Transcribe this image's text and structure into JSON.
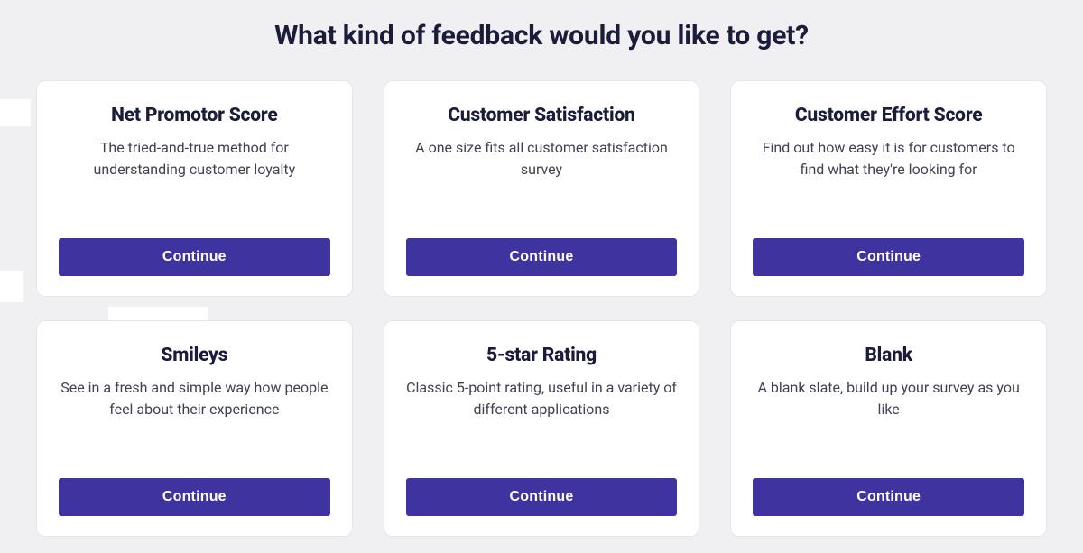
{
  "page": {
    "title": "What kind of feedback would you like to get?"
  },
  "cards": [
    {
      "key": "net-promotor-score",
      "title": "Net Promotor Score",
      "description": "The tried-and-true method for understanding customer loyalty",
      "button_label": "Continue"
    },
    {
      "key": "customer-satisfaction",
      "title": "Customer Satisfaction",
      "description": "A one size fits all customer satisfaction survey",
      "button_label": "Continue"
    },
    {
      "key": "customer-effort-score",
      "title": "Customer Effort Score",
      "description": "Find out how easy it is for customers to find what they're looking for",
      "button_label": "Continue"
    },
    {
      "key": "smileys",
      "title": "Smileys",
      "description": "See in a fresh and simple way how people feel about their experience",
      "button_label": "Continue"
    },
    {
      "key": "5-star-rating",
      "title": "5-star Rating",
      "description": "Classic 5-point rating, useful in a variety of different applications",
      "button_label": "Continue"
    },
    {
      "key": "blank",
      "title": "Blank",
      "description": "A blank slate, build up your survey as you like",
      "button_label": "Continue"
    }
  ]
}
